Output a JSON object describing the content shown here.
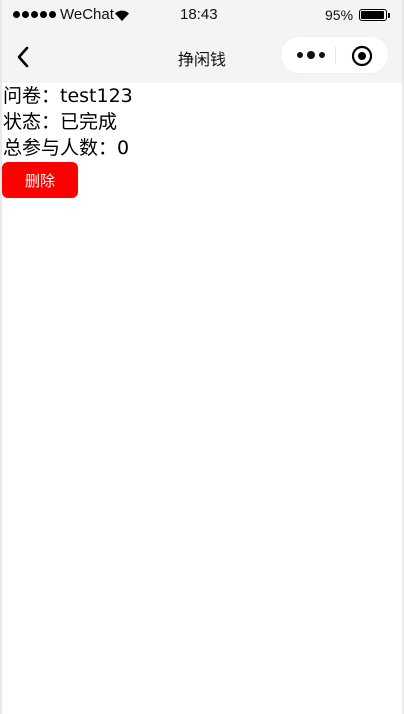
{
  "status_bar": {
    "carrier": "WeChat",
    "time": "18:43",
    "battery_percent": "95%",
    "battery_level": 0.95
  },
  "nav": {
    "title": "挣闲钱",
    "back_icon": "chevron-left-icon",
    "more_icon": "more-dots-icon",
    "close_icon": "target-close-icon"
  },
  "survey": {
    "name_label": "问卷：",
    "name_value": "test123",
    "status_label": "状态：",
    "status_value": "已完成",
    "participants_label": "总参与人数：",
    "participants_value": "0"
  },
  "actions": {
    "delete_label": "删除"
  },
  "colors": {
    "delete_button": "#ff0000",
    "nav_background": "#f4f4f4"
  }
}
